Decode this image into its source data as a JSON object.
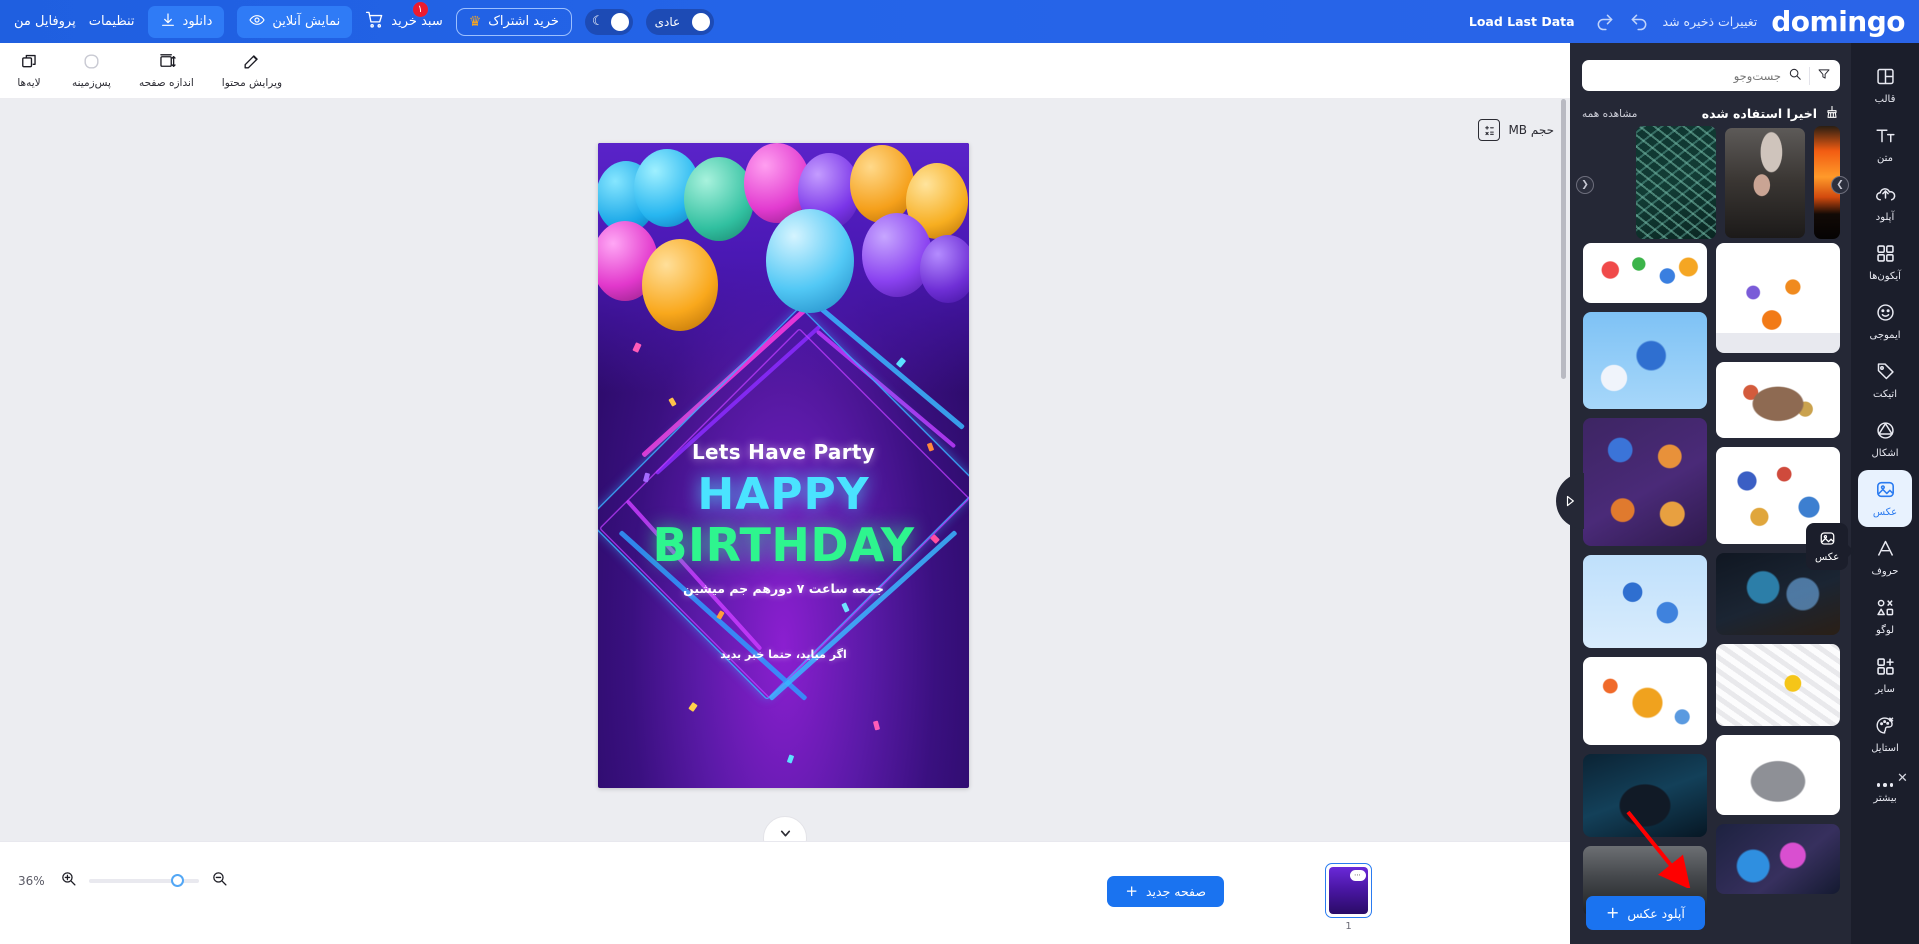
{
  "app": {
    "logo": "domingo"
  },
  "topbar": {
    "saved_text": "تغییرات ذخیره شد",
    "undo_icon": "undo-icon",
    "redo_icon": "redo-icon",
    "load_last_data": "Load Last Data",
    "profile": "پروفایل من",
    "settings": "تنظیمات",
    "download": "دانلود",
    "download_icon": "download-icon",
    "preview_online": "نمایش آنلاین",
    "preview_icon": "eye-icon",
    "cart": "سبد خرید",
    "cart_icon": "cart-icon",
    "cart_badge": "۱",
    "subscribe": "خرید اشتراک",
    "subscribe_icon": "crown-icon",
    "theme_toggle_icon": "moon-icon",
    "mode_label": "عادی"
  },
  "toolbar": {
    "items": [
      {
        "label": "ویرایش محتوا",
        "icon": "edit-pencil-icon"
      },
      {
        "label": "اندازه صفحه",
        "icon": "resize-icon"
      },
      {
        "label": "پس‌زمینه",
        "icon": "background-circle-icon"
      },
      {
        "label": "لایه‌ها",
        "icon": "layers-icon"
      }
    ]
  },
  "canvas": {
    "size_label": "حجم MB",
    "size_icon": "calculator-icon",
    "scroll_down_icon": "chevron-down-icon",
    "poster": {
      "line1": "Lets Have Party",
      "line2": "HAPPY",
      "line3": "BIRTHDAY",
      "subtitle": "جمعه ساعت ۷ دورهم جم میشین",
      "note": "اگر میاید، حتما خبر بدید",
      "colors": {
        "happy": "#4ae3ff",
        "birthday": "#2ef58e",
        "bg_top": "#4a18b4",
        "bg_bottom": "#22085a"
      }
    }
  },
  "bottombar": {
    "zoom_percent": "36%",
    "zoom_in_icon": "zoom-in-icon",
    "zoom_out_icon": "zoom-out-icon",
    "new_page": "صفحه جدید",
    "new_page_icon": "plus-icon",
    "page_number": "1"
  },
  "panel": {
    "search_placeholder": "جست‌وجو",
    "search_icon": "search-icon",
    "filter_icon": "filter-icon",
    "section_title": "اخیرا استفاده شده",
    "section_icon": "broom-icon",
    "view_all": "مشاهده همه",
    "prev_icon": "chevron-left-icon",
    "next_icon": "chevron-right-icon",
    "upload_button": "آپلود عکس",
    "upload_icon": "plus-icon",
    "collapse_icon": "triangle-right-icon",
    "recent": [
      {
        "name": "sunset-gradient-image"
      },
      {
        "name": "mother-and-baby-image"
      },
      {
        "name": "pine-branches-image"
      }
    ],
    "thumbnails": [
      {
        "name": "warehouse-containers-illustration"
      },
      {
        "name": "questions-typography-image"
      },
      {
        "name": "isometric-logistics-hub-image"
      },
      {
        "name": "village-road-isometric-image"
      },
      {
        "name": "purple-logistics-diagram-image"
      },
      {
        "name": "logistics-flow-isometric-image"
      },
      {
        "name": "blue-supply-chain-map-image"
      },
      {
        "name": "ai-technology-person-image"
      },
      {
        "name": "cargo-world-map-image"
      },
      {
        "name": "white-question-marks-image"
      },
      {
        "name": "hacker-dark-image"
      },
      {
        "name": "crashed-car-image"
      },
      {
        "name": "abstract-tech-card-image"
      },
      {
        "name": "accident-scene-image"
      }
    ]
  },
  "rail": {
    "items": [
      {
        "label": "قالب",
        "icon": "template-icon",
        "active": false
      },
      {
        "label": "متن",
        "icon": "text-icon",
        "active": false
      },
      {
        "label": "آپلود",
        "icon": "upload-cloud-icon",
        "active": false
      },
      {
        "label": "آیکون‌ها",
        "icon": "grid-icon",
        "active": false
      },
      {
        "label": "ایموجی",
        "icon": "smiley-icon",
        "active": false
      },
      {
        "label": "اتیکت",
        "icon": "tag-icon",
        "active": false
      },
      {
        "label": "اشکال",
        "icon": "shapes-icon",
        "active": false
      },
      {
        "label": "عکس",
        "icon": "image-icon",
        "active": true
      },
      {
        "label": "حروف",
        "icon": "letter-a-icon",
        "active": false
      },
      {
        "label": "لوگو",
        "icon": "logo-shapes-icon",
        "active": false
      },
      {
        "label": "سایر",
        "icon": "plus-grid-icon",
        "active": false
      },
      {
        "label": "استایل",
        "icon": "palette-icon",
        "active": false
      },
      {
        "label": "بیشتر",
        "icon": "ellipsis-icon",
        "active": false
      }
    ],
    "tooltip_label": "عکس",
    "tooltip_icon": "image-icon",
    "close_icon": "close-icon"
  }
}
